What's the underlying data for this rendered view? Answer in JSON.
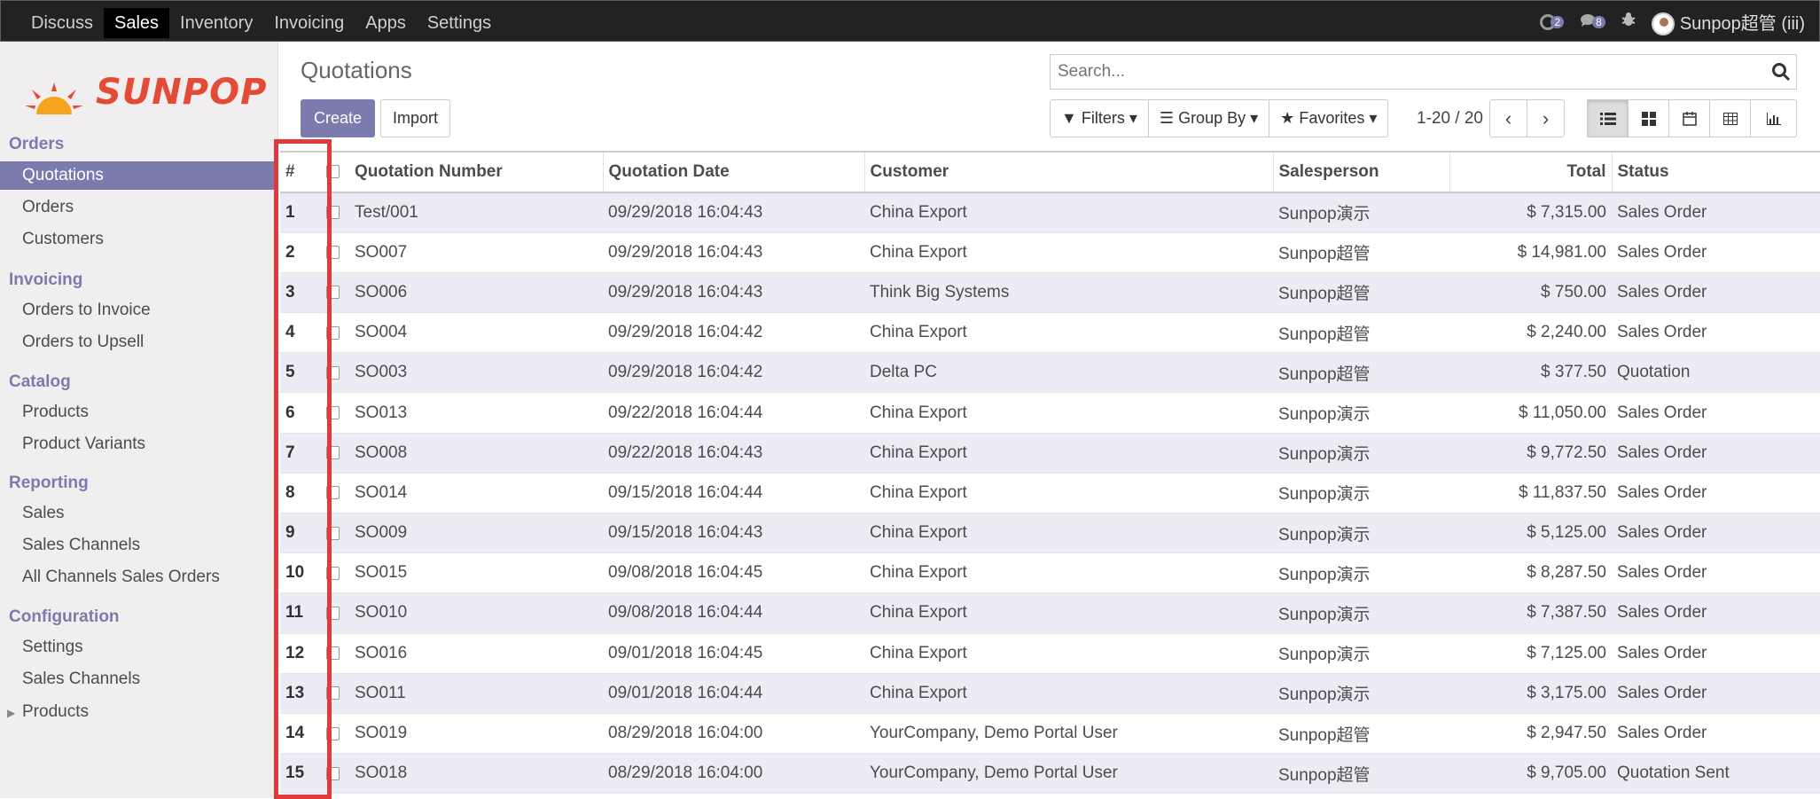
{
  "topbar": {
    "menu": [
      "Discuss",
      "Sales",
      "Inventory",
      "Invoicing",
      "Apps",
      "Settings"
    ],
    "active": "Sales",
    "activity_count": "2",
    "message_count": "8",
    "user_name": "Sunpop超管 (iii)"
  },
  "logo_text": "SUNPOP",
  "sidebar": {
    "sections": [
      {
        "title": "Orders",
        "items": [
          "Quotations",
          "Orders",
          "Customers"
        ]
      },
      {
        "title": "Invoicing",
        "items": [
          "Orders to Invoice",
          "Orders to Upsell"
        ]
      },
      {
        "title": "Catalog",
        "items": [
          "Products",
          "Product Variants"
        ]
      },
      {
        "title": "Reporting",
        "items": [
          "Sales",
          "Sales Channels",
          "All Channels Sales Orders"
        ]
      },
      {
        "title": "Configuration",
        "items": [
          "Settings",
          "Sales Channels",
          "Products"
        ]
      }
    ],
    "active_item": "Quotations"
  },
  "control": {
    "title": "Quotations",
    "create_label": "Create",
    "import_label": "Import",
    "search_placeholder": "Search...",
    "filters_label": "Filters",
    "groupby_label": "Group By",
    "favorites_label": "Favorites",
    "pager": "1-20 / 20"
  },
  "table": {
    "columns": [
      "#",
      "",
      "Quotation Number",
      "Quotation Date",
      "Customer",
      "Salesperson",
      "Total",
      "Status"
    ],
    "rows": [
      [
        "1",
        "Test/001",
        "09/29/2018 16:04:43",
        "China Export",
        "Sunpop演示",
        "$ 7,315.00",
        "Sales Order"
      ],
      [
        "2",
        "SO007",
        "09/29/2018 16:04:43",
        "China Export",
        "Sunpop超管",
        "$ 14,981.00",
        "Sales Order"
      ],
      [
        "3",
        "SO006",
        "09/29/2018 16:04:43",
        "Think Big Systems",
        "Sunpop超管",
        "$ 750.00",
        "Sales Order"
      ],
      [
        "4",
        "SO004",
        "09/29/2018 16:04:42",
        "China Export",
        "Sunpop超管",
        "$ 2,240.00",
        "Sales Order"
      ],
      [
        "5",
        "SO003",
        "09/29/2018 16:04:42",
        "Delta PC",
        "Sunpop超管",
        "$ 377.50",
        "Quotation"
      ],
      [
        "6",
        "SO013",
        "09/22/2018 16:04:44",
        "China Export",
        "Sunpop演示",
        "$ 11,050.00",
        "Sales Order"
      ],
      [
        "7",
        "SO008",
        "09/22/2018 16:04:43",
        "China Export",
        "Sunpop演示",
        "$ 9,772.50",
        "Sales Order"
      ],
      [
        "8",
        "SO014",
        "09/15/2018 16:04:44",
        "China Export",
        "Sunpop演示",
        "$ 11,837.50",
        "Sales Order"
      ],
      [
        "9",
        "SO009",
        "09/15/2018 16:04:43",
        "China Export",
        "Sunpop演示",
        "$ 5,125.00",
        "Sales Order"
      ],
      [
        "10",
        "SO015",
        "09/08/2018 16:04:45",
        "China Export",
        "Sunpop演示",
        "$ 8,287.50",
        "Sales Order"
      ],
      [
        "11",
        "SO010",
        "09/08/2018 16:04:44",
        "China Export",
        "Sunpop演示",
        "$ 7,387.50",
        "Sales Order"
      ],
      [
        "12",
        "SO016",
        "09/01/2018 16:04:45",
        "China Export",
        "Sunpop演示",
        "$ 7,125.00",
        "Sales Order"
      ],
      [
        "13",
        "SO011",
        "09/01/2018 16:04:44",
        "China Export",
        "Sunpop演示",
        "$ 3,175.00",
        "Sales Order"
      ],
      [
        "14",
        "SO019",
        "08/29/2018 16:04:00",
        "YourCompany, Demo Portal User",
        "Sunpop超管",
        "$ 2,947.50",
        "Sales Order"
      ],
      [
        "15",
        "SO018",
        "08/29/2018 16:04:00",
        "YourCompany, Demo Portal User",
        "Sunpop超管",
        "$ 9,705.00",
        "Quotation Sent"
      ]
    ]
  },
  "colors": {
    "accent": "#7c7bad",
    "topbar": "#222222",
    "highlight": "#e23a3a",
    "logo": "#e44b37"
  }
}
